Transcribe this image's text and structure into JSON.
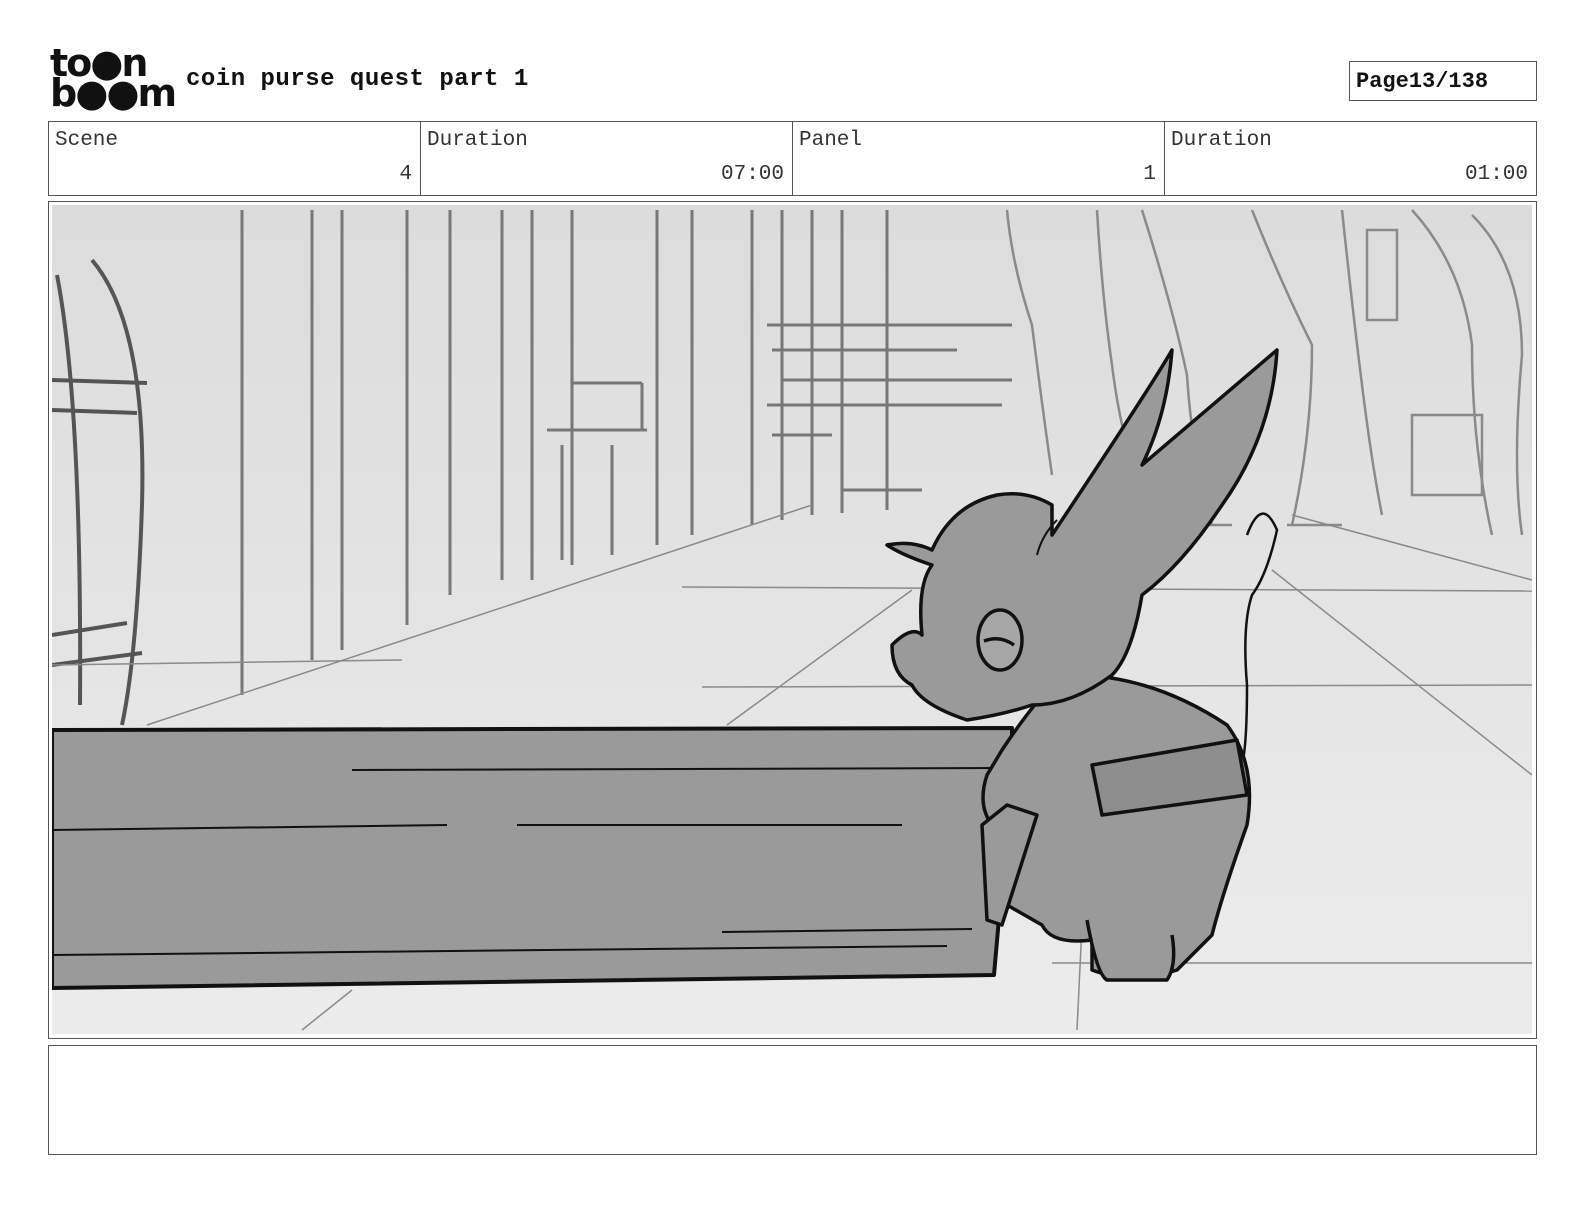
{
  "header": {
    "logo_line1": "to●n",
    "logo_line2": "b●●m",
    "project_title": "coin purse quest part 1",
    "page_label": "Page",
    "page_value": "13/138"
  },
  "info": {
    "scene_label": "Scene",
    "scene_value": "4",
    "scene_duration_label": "Duration",
    "scene_duration_value": "07:00",
    "panel_label": "Panel",
    "panel_value": "1",
    "panel_duration_label": "Duration",
    "panel_duration_value": "01:00"
  },
  "panel_image": {
    "icon": "storyboard-sketch-creature-pushing-log",
    "palette": {
      "background": "#e6e6e6",
      "fill": "#9a9a9a",
      "line": "#1a1a1a",
      "light_line": "#888888"
    }
  },
  "notes": {
    "text": ""
  }
}
